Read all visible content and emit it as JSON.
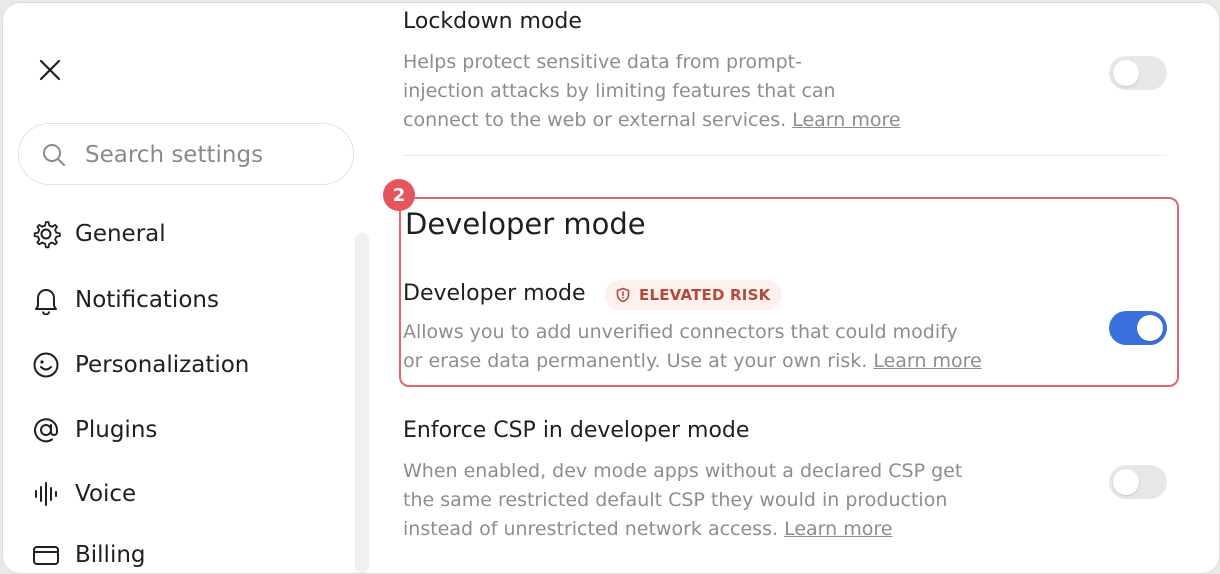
{
  "sidebar": {
    "close_icon": "close-icon",
    "search": {
      "placeholder": "Search settings",
      "value": ""
    },
    "items": [
      {
        "label": "General",
        "icon": "gear-icon"
      },
      {
        "label": "Notifications",
        "icon": "bell-icon"
      },
      {
        "label": "Personalization",
        "icon": "smile-icon"
      },
      {
        "label": "Plugins",
        "icon": "at-icon"
      },
      {
        "label": "Voice",
        "icon": "waveform-icon"
      },
      {
        "label": "Billing",
        "icon": "card-icon"
      }
    ]
  },
  "main": {
    "lockdown": {
      "title": "Lockdown mode",
      "desc_lines": [
        "Helps protect sensitive data from prompt-",
        "injection attacks by limiting features that can",
        "connect to the web or external services."
      ],
      "link": "Learn more",
      "toggle_on": false
    },
    "developer_section": {
      "step_badge": "2",
      "title": "Developer mode",
      "setting_title": "Developer mode",
      "risk_badge": "ELEVATED RISK",
      "desc_lines": [
        "Allows you to add unverified connectors that could modify",
        "or erase data permanently. Use at your own risk."
      ],
      "link": "Learn more",
      "toggle_on": true
    },
    "csp": {
      "title": "Enforce CSP in developer mode",
      "desc_lines": [
        "When enabled, dev mode apps without a declared CSP get",
        "the same restricted default CSP they would in production",
        "instead of unrestricted network access."
      ],
      "link": "Learn more",
      "toggle_on": false
    }
  },
  "colors": {
    "accent": "#3b6fdc",
    "highlight_border": "#e4656a",
    "risk_text": "#b24b3b",
    "risk_bg": "#fdf0ee"
  }
}
